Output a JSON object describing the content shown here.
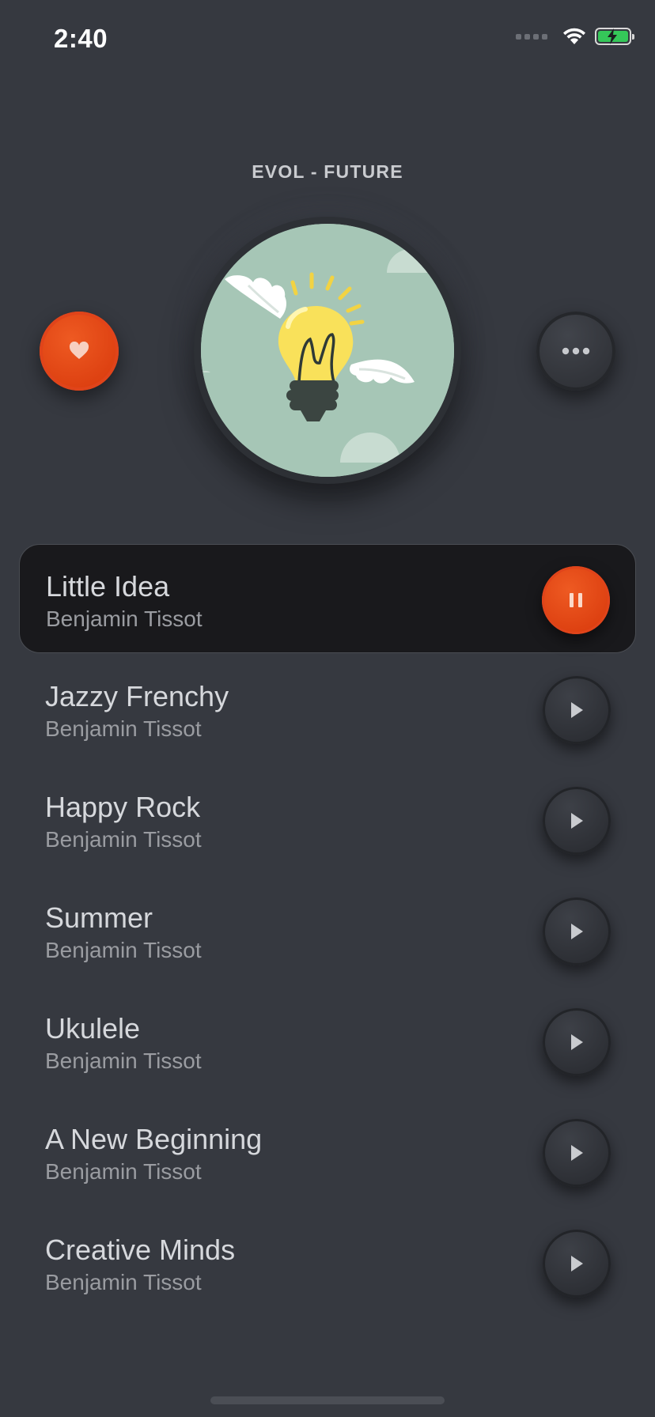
{
  "status_bar": {
    "time": "2:40"
  },
  "album": {
    "title": "EVOL - FUTURE"
  },
  "colors": {
    "background": "#363940",
    "accent": "#e0441a",
    "active_row": "#19191c",
    "battery": "#35c759"
  },
  "icons": {
    "like": "heart-icon",
    "more": "more-horizontal-icon",
    "play": "play-icon",
    "pause": "pause-icon"
  },
  "tracks": [
    {
      "title": "Little Idea",
      "artist": "Benjamin Tissot",
      "state": "playing"
    },
    {
      "title": "Jazzy Frenchy",
      "artist": "Benjamin Tissot",
      "state": "paused"
    },
    {
      "title": "Happy Rock",
      "artist": "Benjamin Tissot",
      "state": "paused"
    },
    {
      "title": "Summer",
      "artist": "Benjamin Tissot",
      "state": "paused"
    },
    {
      "title": "Ukulele",
      "artist": "Benjamin Tissot",
      "state": "paused"
    },
    {
      "title": "A New Beginning",
      "artist": "Benjamin Tissot",
      "state": "paused"
    },
    {
      "title": "Creative Minds",
      "artist": "Benjamin Tissot",
      "state": "paused"
    }
  ]
}
